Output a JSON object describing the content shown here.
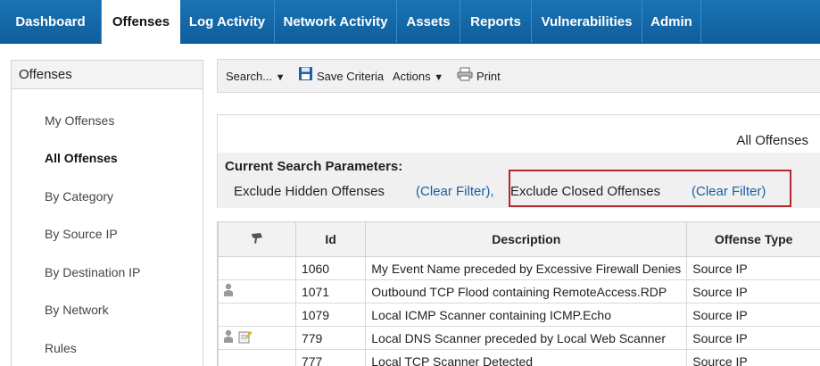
{
  "nav": {
    "tabs": [
      {
        "label": "Dashboard",
        "active": false
      },
      {
        "label": "Offenses",
        "active": true
      },
      {
        "label": "Log Activity",
        "active": false
      },
      {
        "label": "Network Activity",
        "active": false
      },
      {
        "label": "Assets",
        "active": false
      },
      {
        "label": "Reports",
        "active": false
      },
      {
        "label": "Vulnerabilities",
        "active": false
      },
      {
        "label": "Admin",
        "active": false
      }
    ]
  },
  "sidebar": {
    "title": "Offenses",
    "items": [
      {
        "label": "My Offenses",
        "active": false
      },
      {
        "label": "All Offenses",
        "active": true
      },
      {
        "label": "By Category",
        "active": false
      },
      {
        "label": "By Source IP",
        "active": false
      },
      {
        "label": "By Destination IP",
        "active": false
      },
      {
        "label": "By Network",
        "active": false
      },
      {
        "label": "Rules",
        "active": false
      }
    ]
  },
  "toolbar": {
    "search_label": "Search...",
    "save_label": "Save Criteria",
    "actions_label": "Actions",
    "print_label": "Print"
  },
  "page_title": "All Offenses",
  "search_params": {
    "label": "Current Search Parameters:",
    "filters": [
      {
        "text": "Exclude Hidden Offenses",
        "link": "(Clear Filter),"
      },
      {
        "text": "Exclude Closed Offenses",
        "link": "(Clear Filter)"
      }
    ]
  },
  "table": {
    "columns": [
      "",
      "Id",
      "Description",
      "Offense Type"
    ],
    "rows": [
      {
        "icons": [],
        "id": "1060",
        "description": "My Event Name preceded by Excessive Firewall Denies",
        "type": "Source IP"
      },
      {
        "icons": [
          "person-icon"
        ],
        "id": "1071",
        "description": "Outbound TCP Flood containing RemoteAccess.RDP",
        "type": "Source IP"
      },
      {
        "icons": [],
        "id": "1079",
        "description": "Local ICMP Scanner containing ICMP.Echo",
        "type": "Source IP"
      },
      {
        "icons": [
          "person-icon",
          "note-icon"
        ],
        "id": "779",
        "description": "Local DNS Scanner preceded by Local Web Scanner",
        "type": "Source IP"
      },
      {
        "icons": [],
        "id": "777",
        "description": "Local TCP Scanner Detected",
        "type": "Source IP"
      }
    ]
  },
  "colors": {
    "nav_bg": "#1468a8",
    "link": "#1a5fa3",
    "highlight_border": "#b3272d"
  }
}
